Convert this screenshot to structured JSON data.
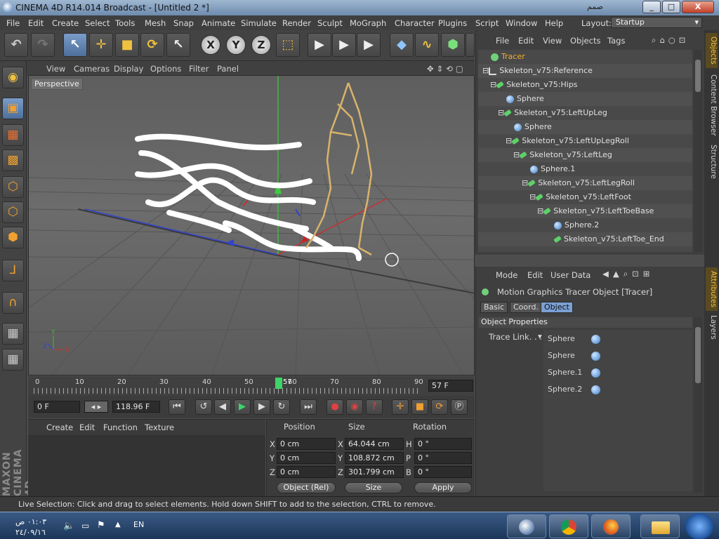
{
  "window": {
    "title": "CINEMA 4D R14.014 Broadcast - [Untitled 2 *]",
    "arabic_text": "صمم",
    "min": "_",
    "max": "□",
    "close": "X"
  },
  "menubar": {
    "items": [
      "File",
      "Edit",
      "Create",
      "Select",
      "Tools",
      "Mesh",
      "Snap",
      "Animate",
      "Simulate",
      "Render",
      "Sculpt",
      "MoGraph",
      "Character",
      "Plugins",
      "Script",
      "Window",
      "Help"
    ],
    "layout_label": "Layout:",
    "layout_value": "Startup"
  },
  "toolbar": {
    "axis_x": "X",
    "axis_y": "Y",
    "axis_z": "Z"
  },
  "viewport": {
    "menu": [
      "View",
      "Cameras",
      "Display",
      "Options",
      "Filter",
      "Panel"
    ],
    "label": "Perspective",
    "mini_axis": {
      "y": "Y",
      "x": "X",
      "z": "Z"
    }
  },
  "timeline": {
    "ticks": [
      "0",
      "10",
      "20",
      "30",
      "40",
      "50",
      "60",
      "70",
      "80",
      "90"
    ],
    "current_frame_marker": "57",
    "current_frame_field": "57 F",
    "start_field": "0 F",
    "end_field": "118.96 F"
  },
  "materials": {
    "menu": [
      "Create",
      "Edit",
      "Function",
      "Texture"
    ]
  },
  "coords": {
    "headers": [
      "Position",
      "Size",
      "Rotation"
    ],
    "rows": [
      {
        "pos_axis": "X",
        "pos": "0 cm",
        "size_axis": "X",
        "size": "64.044 cm",
        "rot_axis": "H",
        "rot": "0 °"
      },
      {
        "pos_axis": "Y",
        "pos": "0 cm",
        "size_axis": "Y",
        "size": "108.872 cm",
        "rot_axis": "P",
        "rot": "0 °"
      },
      {
        "pos_axis": "Z",
        "pos": "0 cm",
        "size_axis": "Z",
        "size": "301.799 cm",
        "rot_axis": "B",
        "rot": "0 °"
      }
    ],
    "mode_select": "Object (Rel)",
    "size_select": "Size",
    "apply": "Apply"
  },
  "status": "Live Selection: Click and drag to select elements. Hold down SHIFT to add to the selection, CTRL to remove.",
  "objects": {
    "menu": [
      "File",
      "Edit",
      "View",
      "Objects",
      "Tags"
    ],
    "tree": [
      {
        "label": "Tracer",
        "icon": "tracer",
        "indent": 0,
        "highlight": true
      },
      {
        "label": "Skeleton_v75:Reference",
        "icon": "ref",
        "indent": 0
      },
      {
        "label": "Skeleton_v75:Hips",
        "icon": "bone",
        "indent": 1
      },
      {
        "label": "Sphere",
        "icon": "sphere",
        "indent": 2
      },
      {
        "label": "Skeleton_v75:LeftUpLeg",
        "icon": "bone",
        "indent": 2
      },
      {
        "label": "Sphere",
        "icon": "sphere",
        "indent": 3
      },
      {
        "label": "Skeleton_v75:LeftUpLegRoll",
        "icon": "bone",
        "indent": 3
      },
      {
        "label": "Skeleton_v75:LeftLeg",
        "icon": "bone",
        "indent": 4
      },
      {
        "label": "Sphere.1",
        "icon": "sphere",
        "indent": 5
      },
      {
        "label": "Skeleton_v75:LeftLegRoll",
        "icon": "bone",
        "indent": 5
      },
      {
        "label": "Skeleton_v75:LeftFoot",
        "icon": "bone",
        "indent": 6
      },
      {
        "label": "Skeleton_v75:LeftToeBase",
        "icon": "bone",
        "indent": 7
      },
      {
        "label": "Sphere.2",
        "icon": "sphere",
        "indent": 8
      },
      {
        "label": "Skeleton_v75:LeftToe_End",
        "icon": "bone",
        "indent": 8
      }
    ]
  },
  "attributes": {
    "menu": [
      "Mode",
      "Edit",
      "User Data"
    ],
    "object_title": "Motion Graphics Tracer Object [Tracer]",
    "tabs": [
      "Basic",
      "Coord.",
      "Object"
    ],
    "active_tab": "Object",
    "section": "Object Properties",
    "trace_link_label": "Trace Link. . .",
    "trace_links": [
      "Sphere",
      "Sphere",
      "Sphere.1",
      "Sphere.2"
    ]
  },
  "side_tabs": [
    "Objects",
    "Content Browser",
    "Structure",
    "Attributes",
    "Layers"
  ],
  "taskbar": {
    "time": "٠١:٠٣ ص",
    "date": "٢٤/٠٩/١٦",
    "lang": "EN"
  }
}
